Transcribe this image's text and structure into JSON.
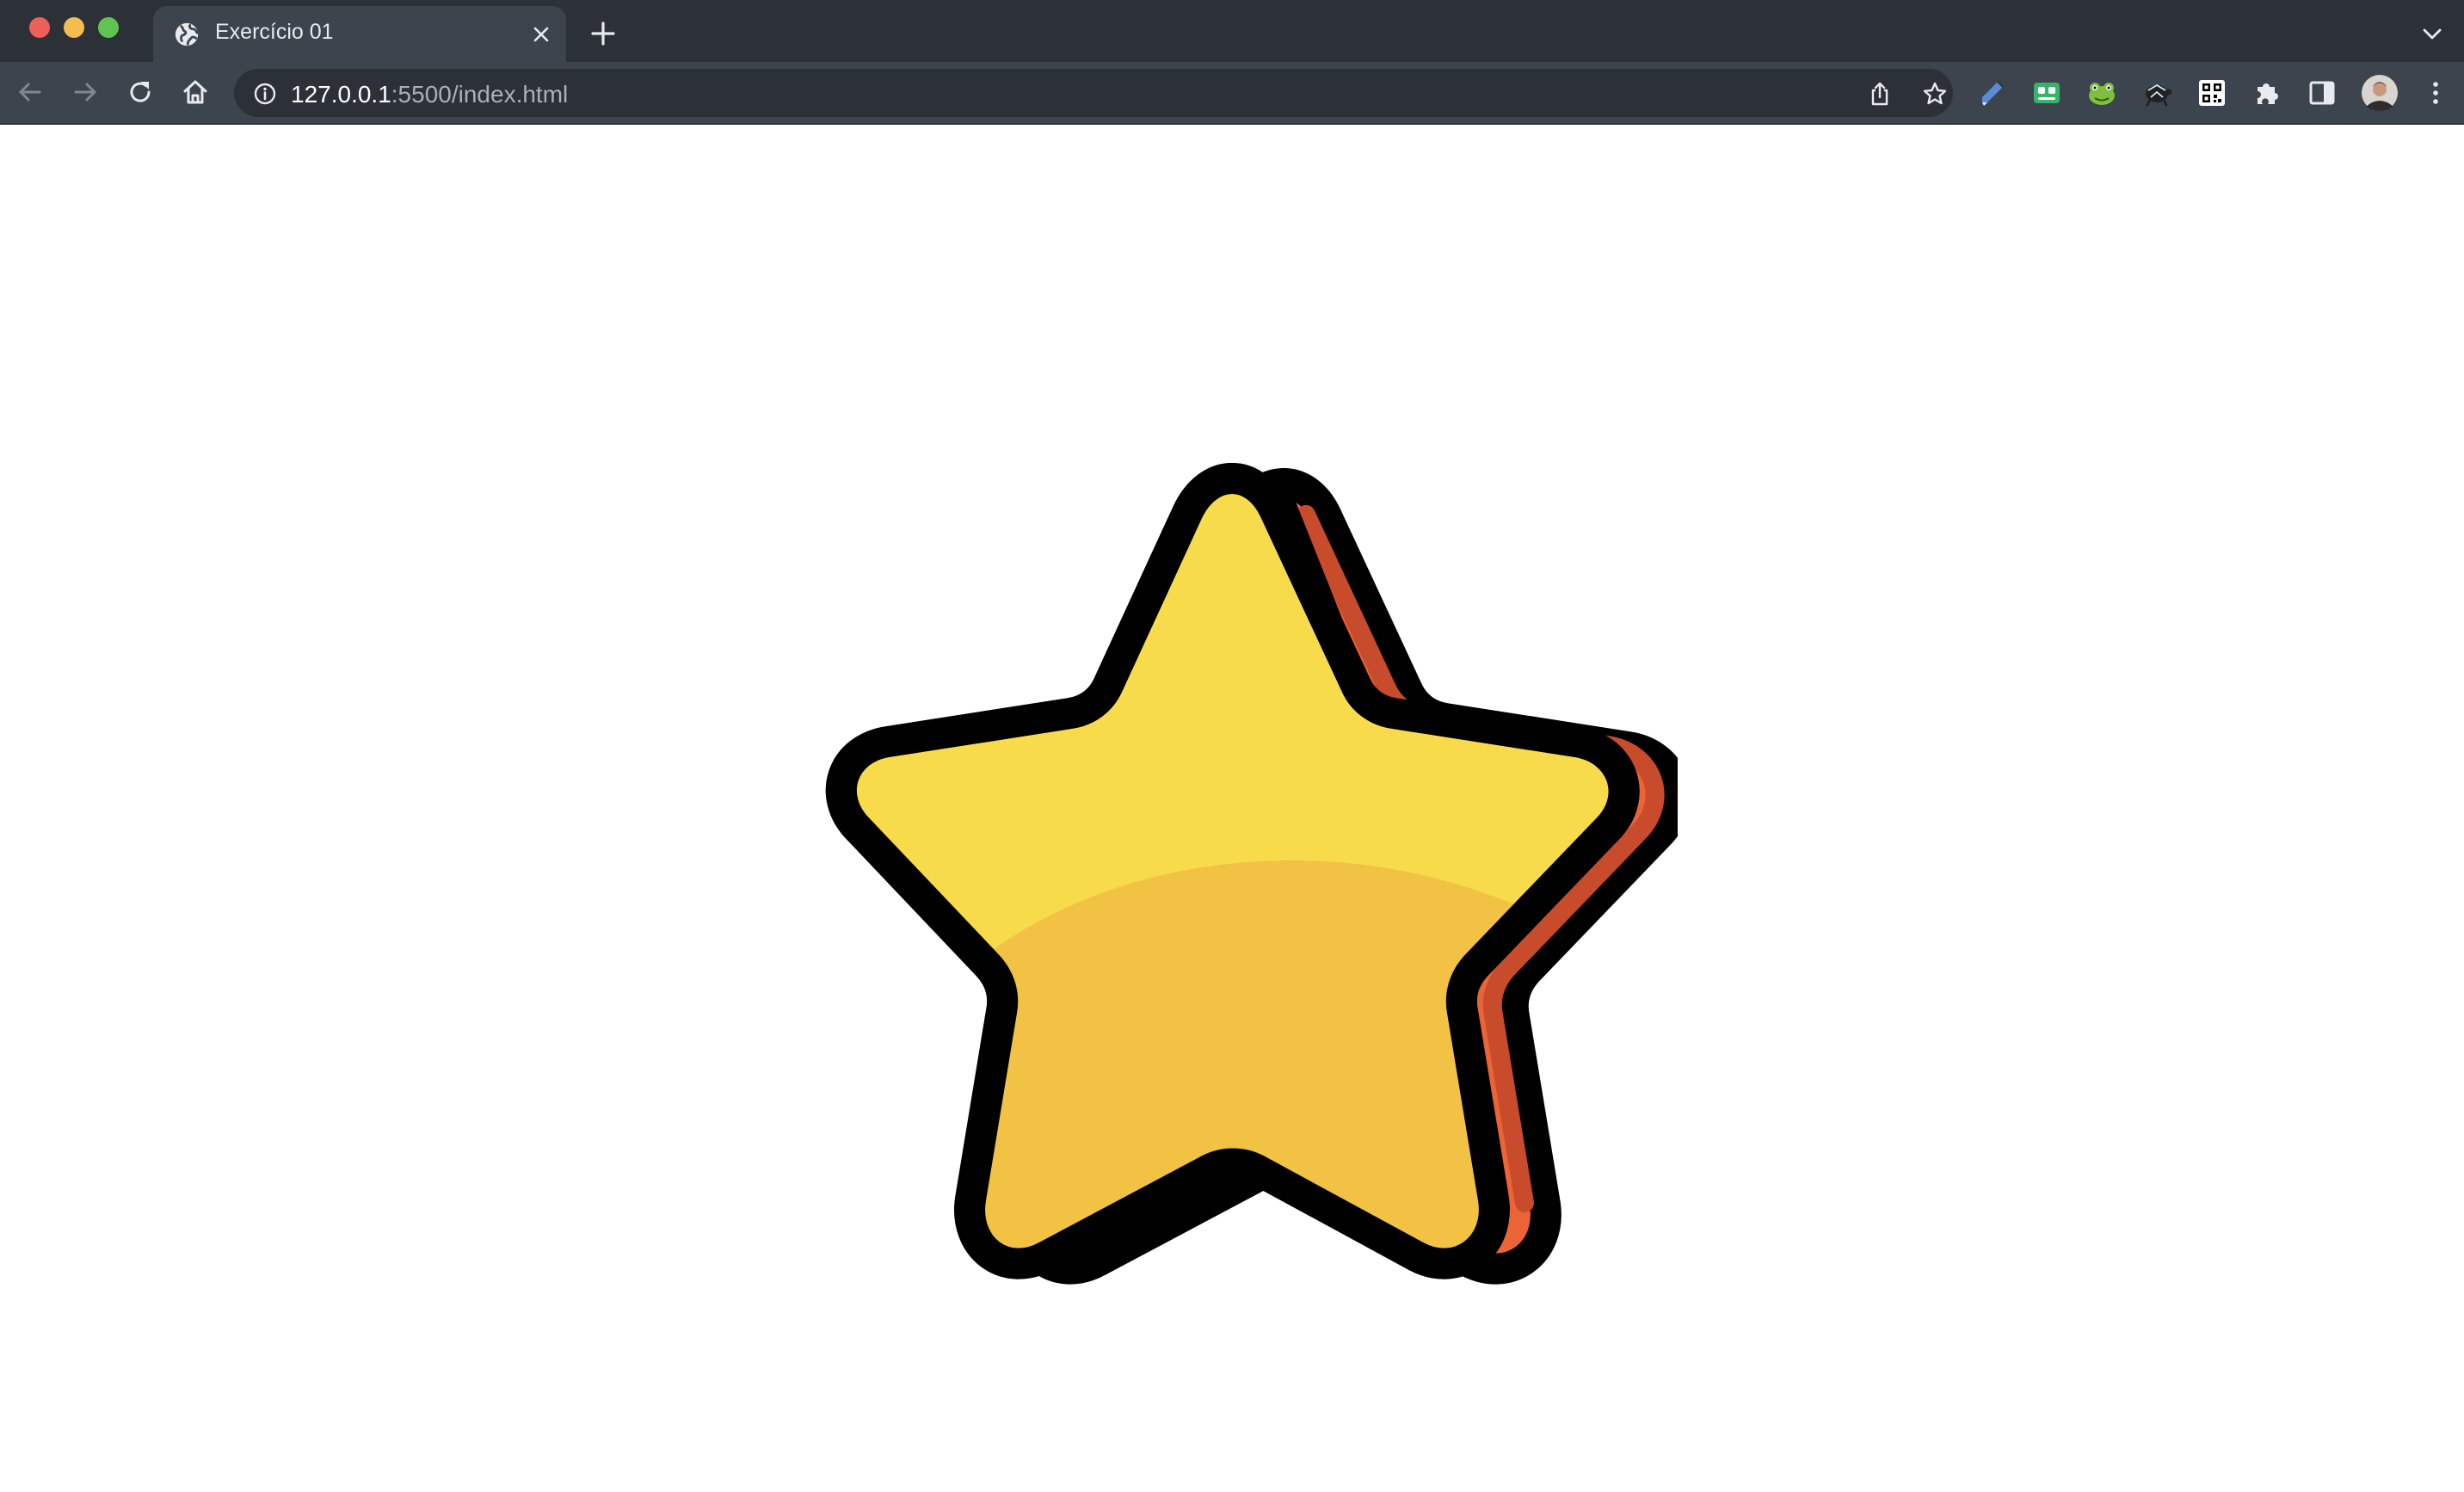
{
  "browser": {
    "tab": {
      "title": "Exercício 01"
    },
    "address_bar": {
      "url_host": "127.0.0.1",
      "url_rest": ":5500/index.html"
    }
  },
  "page": {
    "image": {
      "subject": "star",
      "colors": {
        "face": "#f8db4a",
        "face_shade": "#f2c244",
        "side": "#ec6435",
        "side_shade": "#c84b2b",
        "outline": "#000000"
      }
    }
  }
}
